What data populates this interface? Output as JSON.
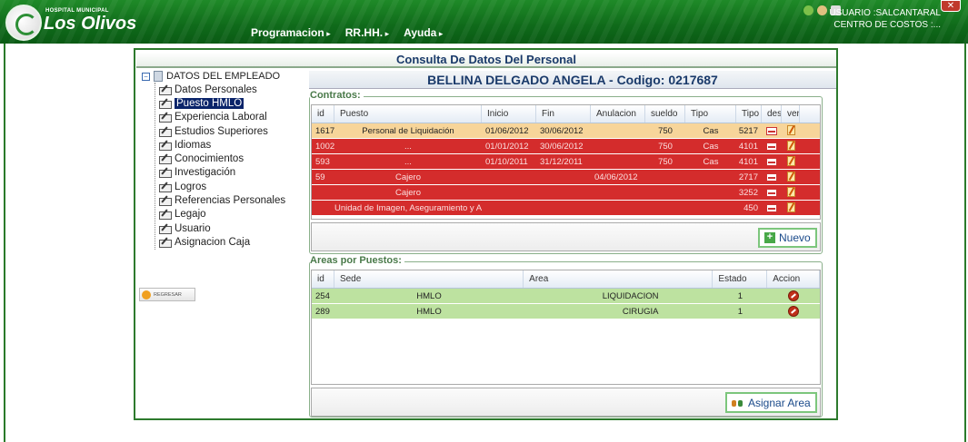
{
  "header": {
    "logo_small": "HOSPITAL MUNICIPAL",
    "logo_big": "Los Olivos",
    "menu": [
      "Programacion",
      "RR.HH.",
      "Ayuda"
    ],
    "user_label": "USUARIO :SALCANTARAL",
    "cost_center": "CENTRO DE COSTOS :...",
    "close_label": "✕"
  },
  "sidebar": {
    "root_label": "DATOS DEL EMPLEADO",
    "items": [
      {
        "label": "Datos Personales"
      },
      {
        "label": "Puesto HMLO"
      },
      {
        "label": "Experiencia Laboral"
      },
      {
        "label": "Estudios Superiores"
      },
      {
        "label": "Idiomas"
      },
      {
        "label": "Conocimientos"
      },
      {
        "label": "Investigación"
      },
      {
        "label": "Logros"
      },
      {
        "label": "Referencias Personales"
      },
      {
        "label": "Legajo"
      },
      {
        "label": "Usuario"
      },
      {
        "label": "Asignacion Caja"
      }
    ],
    "back_label": "REGRESAR"
  },
  "main": {
    "title": "Consulta De Datos Del Personal",
    "employee": "BELLINA DELGADO ANGELA - Codigo: 0217687",
    "contracts": {
      "legend": "Contratos:",
      "columns": [
        "id",
        "Puesto",
        "Inicio",
        "Fin",
        "Anulacion",
        "sueldo",
        "Tipo",
        "Tipo",
        "des",
        "ver"
      ],
      "rows": [
        {
          "id": "1617",
          "puesto": "Personal de Liquidación",
          "inicio": "01/06/2012",
          "fin": "30/06/2012",
          "anulacion": "",
          "sueldo": "750",
          "tipo": "Cas",
          "tipo2": "5217",
          "style": "orange"
        },
        {
          "id": "1002",
          "puesto": "...",
          "inicio": "01/01/2012",
          "fin": "30/06/2012",
          "anulacion": "",
          "sueldo": "750",
          "tipo": "Cas",
          "tipo2": "4101",
          "style": "red"
        },
        {
          "id": "593",
          "puesto": "...",
          "inicio": "01/10/2011",
          "fin": "31/12/2011",
          "anulacion": "",
          "sueldo": "750",
          "tipo": "Cas",
          "tipo2": "4101",
          "style": "red"
        },
        {
          "id": "59",
          "puesto": "Cajero",
          "inicio": "",
          "fin": "",
          "anulacion": "04/06/2012",
          "sueldo": "",
          "tipo": "",
          "tipo2": "2717",
          "style": "red"
        },
        {
          "id": "",
          "puesto": "Cajero",
          "inicio": "",
          "fin": "",
          "anulacion": "",
          "sueldo": "",
          "tipo": "",
          "tipo2": "3252",
          "style": "red"
        },
        {
          "id": "",
          "puesto": "Unidad de Imagen, Aseguramiento y At",
          "inicio": "",
          "fin": "",
          "anulacion": "",
          "sueldo": "",
          "tipo": "",
          "tipo2": "450",
          "style": "red"
        }
      ],
      "new_button": "Nuevo"
    },
    "areas": {
      "legend": "Areas por Puestos:",
      "columns": [
        "id",
        "Sede",
        "Area",
        "Estado",
        "Accion"
      ],
      "rows": [
        {
          "id": "254",
          "sede": "HMLO",
          "area": "LIQUIDACION",
          "estado": "1"
        },
        {
          "id": "289",
          "sede": "HMLO",
          "area": "CIRUGIA",
          "estado": "1"
        }
      ],
      "assign_button": "Asignar Area"
    }
  }
}
